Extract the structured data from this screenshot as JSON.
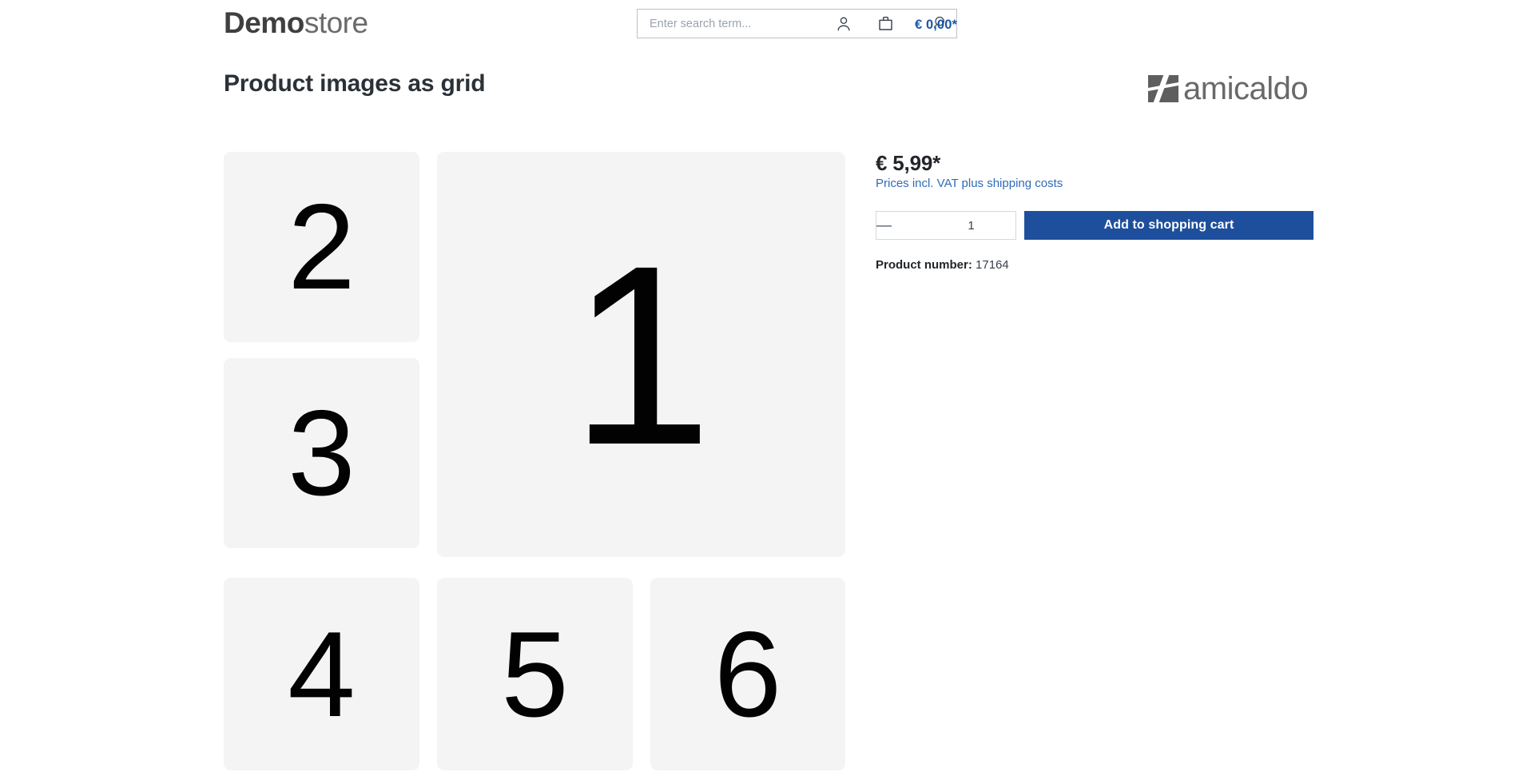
{
  "header": {
    "brand_strong": "Demo",
    "brand_light": "store",
    "search": {
      "placeholder": "Enter search term...",
      "value": "",
      "icon": "search-icon"
    },
    "account_icon": "user-icon",
    "cart_icon": "shopping-bag-icon",
    "cart_total": "€ 0,00*"
  },
  "page": {
    "title": "Product images as grid"
  },
  "manufacturer": {
    "name": "amicaldo",
    "logo_icon": "amicaldo-logo-mark"
  },
  "gallery": {
    "tiles": [
      {
        "label": "2",
        "position": "top-left-small"
      },
      {
        "label": "3",
        "position": "middle-left-small"
      },
      {
        "label": "1",
        "position": "main-large"
      },
      {
        "label": "4",
        "position": "bottom-col1"
      },
      {
        "label": "5",
        "position": "bottom-col2"
      },
      {
        "label": "6",
        "position": "bottom-col3"
      }
    ]
  },
  "buybox": {
    "price": "€ 5,99*",
    "tax_note": "Prices incl. VAT plus shipping costs",
    "quantity": {
      "decrease_label": "—",
      "value": "1",
      "increase_label": "+"
    },
    "add_to_cart_label": "Add to shopping cart",
    "product_number_label": "Product number:",
    "product_number_value": "17164"
  },
  "colors": {
    "accent_blue": "#1d4f9c",
    "link_blue": "#2f6bb8",
    "cart_blue": "#1a56a6",
    "tile_bg": "#f4f4f4",
    "title_dark": "#2b3138"
  }
}
